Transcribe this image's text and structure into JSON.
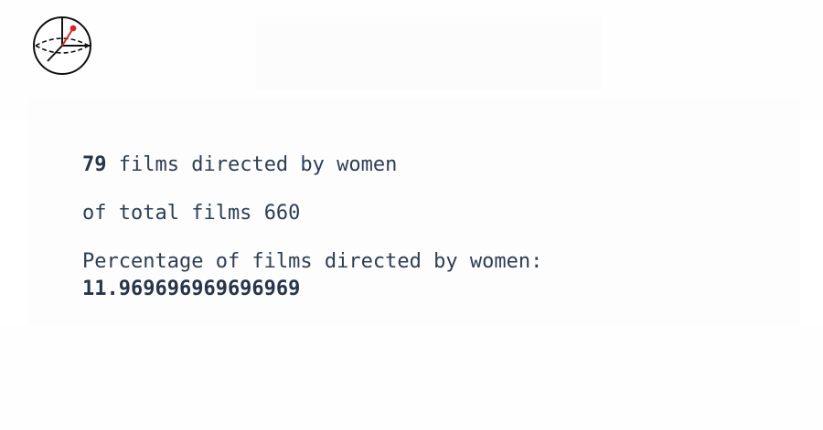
{
  "logo": {
    "icon": "globe-clock-icon",
    "accent_color": "#d62728"
  },
  "stats": {
    "women_count": "79",
    "women_label": "films directed by women",
    "total_prefix": "of total films",
    "total_count": "660",
    "percentage_label": "Percentage of films directed by women:",
    "percentage_value": "11.969696969696969"
  },
  "colors": {
    "text": "#2e3e55",
    "background": "#ffffff"
  }
}
